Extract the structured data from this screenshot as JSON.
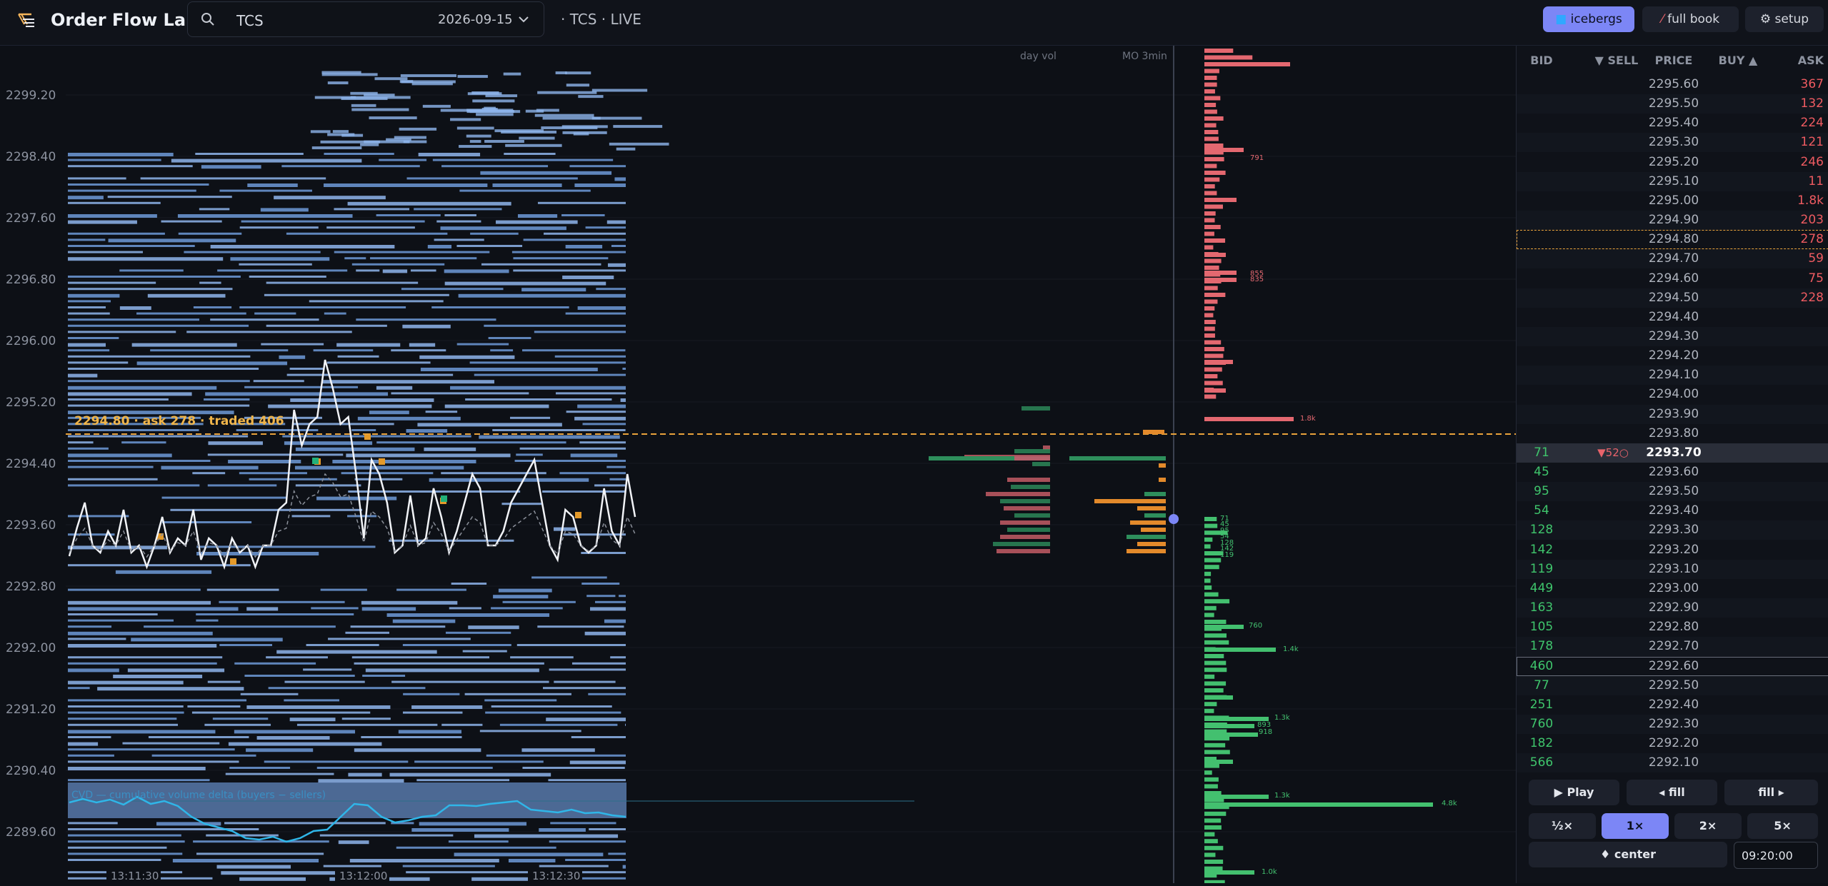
{
  "app": {
    "title": "Order Flow Lab"
  },
  "search": {
    "value": "TCS",
    "date": "2026-09-15"
  },
  "session_label": "· TCS · LIVE",
  "toolbar": {
    "icebergs": "icebergs",
    "full_book": "full book",
    "setup": "⚙ setup"
  },
  "colors": {
    "accent": "#7c86f6",
    "bid": "#3fc56c",
    "ask": "#ef5b61",
    "iceberg_line": "#e9a23b",
    "price_line": "#ffffff",
    "cvd": "#2fb6e8"
  },
  "chart": {
    "price_ticks": [
      "2299.20",
      "2298.40",
      "2297.60",
      "2296.80",
      "2296.00",
      "2295.20",
      "2294.40",
      "2293.60",
      "2292.80",
      "2292.00",
      "2291.20",
      "2290.40",
      "2289.60"
    ],
    "time_ticks": [
      "13:11:30",
      "13:12:00",
      "13:12:30"
    ],
    "annotation": "2294.80 · ask 278 · traded 406",
    "col_day_vol": "day vol",
    "col_mo": "MO 3min",
    "cvd_label": "CVD — cumulative volume delta (buyers − sellers)",
    "depth_labels": [
      "791",
      "855",
      "835",
      "1.8k",
      "71",
      "45",
      "95",
      "54",
      "128",
      "142",
      "119",
      "760",
      "1.4k",
      "1.3k",
      "893",
      "918",
      "1.3k",
      "4.8k",
      "1.0k"
    ]
  },
  "ladder": {
    "headers": {
      "bid": "BID",
      "sell": "▼ SELL",
      "price": "PRICE",
      "buy": "BUY ▲",
      "ask": "ASK"
    },
    "rows": [
      {
        "bid": "",
        "sell": "",
        "price": "2295.60",
        "ask": "367"
      },
      {
        "bid": "",
        "sell": "",
        "price": "2295.50",
        "ask": "132"
      },
      {
        "bid": "",
        "sell": "",
        "price": "2295.40",
        "ask": "224"
      },
      {
        "bid": "",
        "sell": "",
        "price": "2295.30",
        "ask": "121"
      },
      {
        "bid": "",
        "sell": "",
        "price": "2295.20",
        "ask": "246"
      },
      {
        "bid": "",
        "sell": "",
        "price": "2295.10",
        "ask": "11"
      },
      {
        "bid": "",
        "sell": "",
        "price": "2295.00",
        "ask": "1.8k"
      },
      {
        "bid": "",
        "sell": "",
        "price": "2294.90",
        "ask": "203"
      },
      {
        "bid": "",
        "sell": "",
        "price": "2294.80",
        "ask": "278"
      },
      {
        "bid": "",
        "sell": "",
        "price": "2294.70",
        "ask": "59"
      },
      {
        "bid": "",
        "sell": "",
        "price": "2294.60",
        "ask": "75"
      },
      {
        "bid": "",
        "sell": "",
        "price": "2294.50",
        "ask": "228"
      },
      {
        "bid": "",
        "sell": "",
        "price": "2294.40",
        "ask": ""
      },
      {
        "bid": "",
        "sell": "",
        "price": "2294.30",
        "ask": ""
      },
      {
        "bid": "",
        "sell": "",
        "price": "2294.20",
        "ask": ""
      },
      {
        "bid": "",
        "sell": "",
        "price": "2294.10",
        "ask": ""
      },
      {
        "bid": "",
        "sell": "",
        "price": "2294.00",
        "ask": ""
      },
      {
        "bid": "",
        "sell": "",
        "price": "2293.90",
        "ask": ""
      },
      {
        "bid": "",
        "sell": "",
        "price": "2293.80",
        "ask": ""
      },
      {
        "bid": "71",
        "sell": "▼52○",
        "price": "2293.70",
        "ask": ""
      },
      {
        "bid": "45",
        "sell": "",
        "price": "2293.60",
        "ask": ""
      },
      {
        "bid": "95",
        "sell": "",
        "price": "2293.50",
        "ask": ""
      },
      {
        "bid": "54",
        "sell": "",
        "price": "2293.40",
        "ask": ""
      },
      {
        "bid": "128",
        "sell": "",
        "price": "2293.30",
        "ask": ""
      },
      {
        "bid": "142",
        "sell": "",
        "price": "2293.20",
        "ask": ""
      },
      {
        "bid": "119",
        "sell": "",
        "price": "2293.10",
        "ask": ""
      },
      {
        "bid": "449",
        "sell": "",
        "price": "2293.00",
        "ask": ""
      },
      {
        "bid": "163",
        "sell": "",
        "price": "2292.90",
        "ask": ""
      },
      {
        "bid": "105",
        "sell": "",
        "price": "2292.80",
        "ask": ""
      },
      {
        "bid": "178",
        "sell": "",
        "price": "2292.70",
        "ask": ""
      },
      {
        "bid": "460",
        "sell": "",
        "price": "2292.60",
        "ask": ""
      },
      {
        "bid": "77",
        "sell": "",
        "price": "2292.50",
        "ask": ""
      },
      {
        "bid": "251",
        "sell": "",
        "price": "2292.40",
        "ask": ""
      },
      {
        "bid": "760",
        "sell": "",
        "price": "2292.30",
        "ask": ""
      },
      {
        "bid": "182",
        "sell": "",
        "price": "2292.20",
        "ask": ""
      },
      {
        "bid": "566",
        "sell": "",
        "price": "2292.10",
        "ask": ""
      }
    ]
  },
  "controls": {
    "play": "▶ Play",
    "fill_back": "◂ fill",
    "fill_fwd": "fill ▸",
    "half": "½×",
    "one": "1×",
    "two": "2×",
    "five": "5×",
    "center": "♦ center",
    "time": "09:20:00"
  }
}
